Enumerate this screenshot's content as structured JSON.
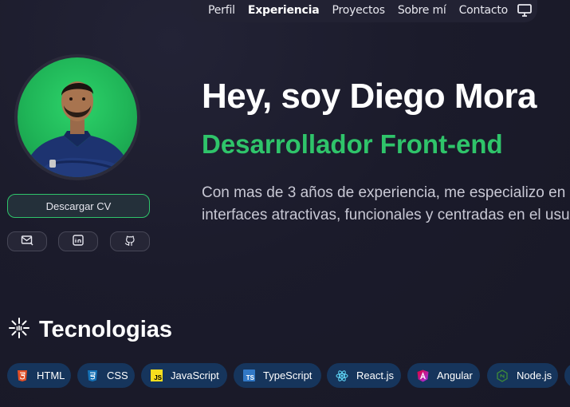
{
  "nav": {
    "items": [
      {
        "label": "Perfil"
      },
      {
        "label": "Experiencia",
        "active": true
      },
      {
        "label": "Proyectos"
      },
      {
        "label": "Sobre mí"
      },
      {
        "label": "Contacto"
      }
    ],
    "theme_icon": "monitor-icon"
  },
  "profile": {
    "avatar_bg": "#2dd36a",
    "cv_button": "Descargar CV",
    "socials": [
      "mail-icon",
      "linkedin-icon",
      "github-icon"
    ]
  },
  "hero": {
    "title": "Hey, soy Diego Mora",
    "role": "Desarrollador Front-end",
    "desc_line1": "Con mas de 3 años de experiencia, me especializo en",
    "desc_line2": "interfaces atractivas, funcionales y centradas en el usuario."
  },
  "tech": {
    "heading": "Tecnologias",
    "heading_icon": "spark-icon",
    "items": [
      {
        "label": "HTML",
        "icon": "html5-icon",
        "color": "#e34f26"
      },
      {
        "label": "CSS",
        "icon": "css3-icon",
        "color": "#1572b6"
      },
      {
        "label": "JavaScript",
        "icon": "js-icon",
        "color": "#f7df1e"
      },
      {
        "label": "TypeScript",
        "icon": "ts-icon",
        "color": "#3178c6"
      },
      {
        "label": "React.js",
        "icon": "react-icon",
        "color": "#61dafb"
      },
      {
        "label": "Angular",
        "icon": "angular-icon",
        "color": "#c3002f"
      },
      {
        "label": "Node.js",
        "icon": "nodejs-icon",
        "color": "#3c873a"
      }
    ]
  },
  "colors": {
    "accent": "#2fc46a",
    "background": "#1b1b2b",
    "chip_bg": "#16355c"
  }
}
